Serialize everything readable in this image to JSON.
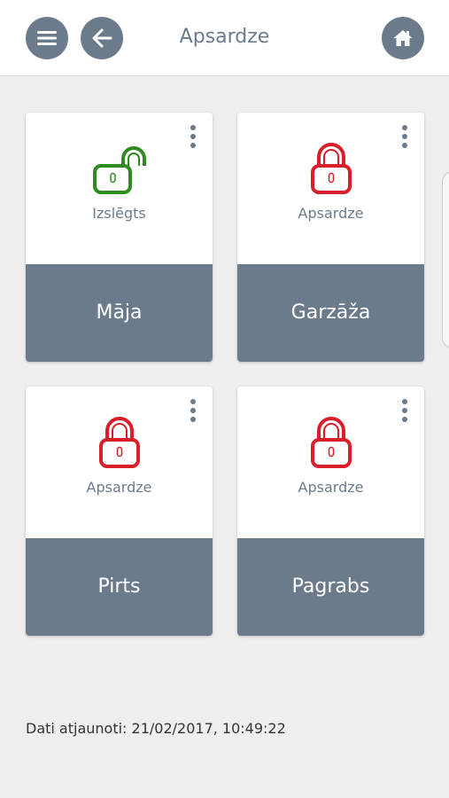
{
  "header": {
    "title": "Apsardze",
    "menu_icon": "menu-icon",
    "back_icon": "arrow-left-icon",
    "home_icon": "home-icon"
  },
  "colors": {
    "accent": "#6c7b8c",
    "unlocked": "#2e8b1f",
    "locked": "#d81f2a"
  },
  "zones": [
    {
      "name": "Māja",
      "status": "Izslēgts",
      "state": "unlocked"
    },
    {
      "name": "Garzāža",
      "status": "Apsardze",
      "state": "locked"
    },
    {
      "name": "Pirts",
      "status": "Apsardze",
      "state": "locked"
    },
    {
      "name": "Pagrabs",
      "status": "Apsardze",
      "state": "locked"
    }
  ],
  "footer": {
    "updated_text": "Dati atjaunoti: 21/02/2017, 10:49:22"
  }
}
